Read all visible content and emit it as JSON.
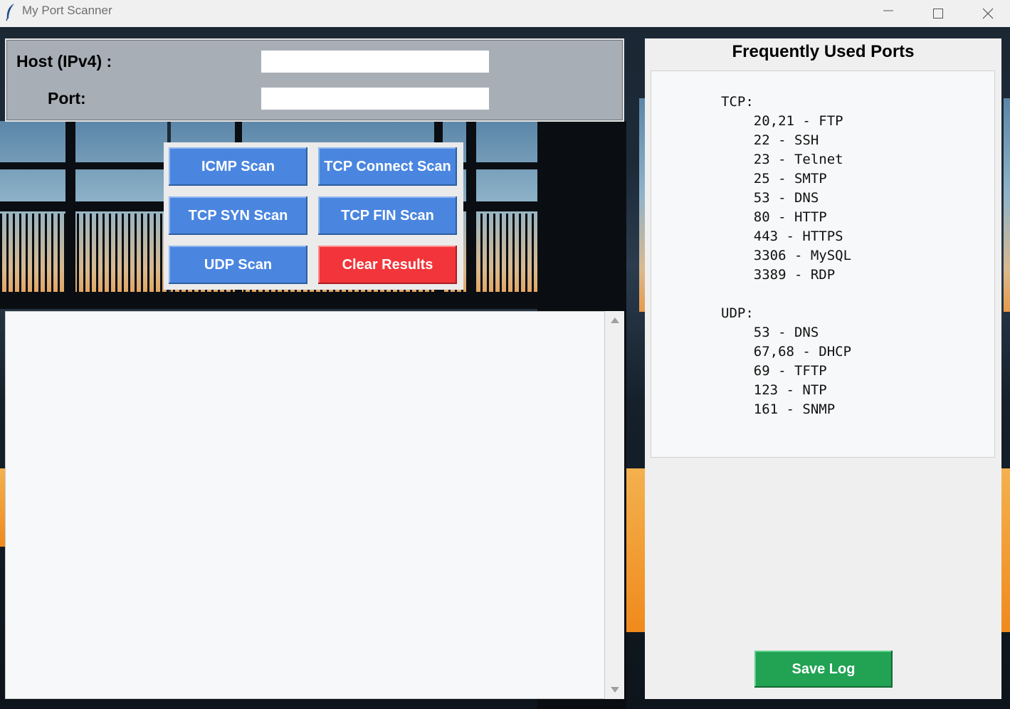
{
  "window": {
    "title": "My Port Scanner",
    "icon": "feather-icon",
    "controls": [
      "minimize-icon",
      "maximize-icon",
      "close-icon"
    ]
  },
  "form": {
    "host_label": "Host (IPv4) :",
    "port_label": "Port:",
    "host_value": "",
    "port_value": ""
  },
  "buttons": {
    "icmp": "ICMP Scan",
    "tcp_connect": "TCP Connect Scan",
    "tcp_syn": "TCP SYN Scan",
    "tcp_fin": "TCP FIN Scan",
    "udp": "UDP Scan",
    "clear": "Clear Results",
    "save_log": "Save Log"
  },
  "results": {
    "text": ""
  },
  "ports_panel": {
    "title": "Frequently Used Ports",
    "text": "TCP:\n    20,21 - FTP\n    22 - SSH\n    23 - Telnet\n    25 - SMTP\n    53 - DNS\n    80 - HTTP\n    443 - HTTPS\n    3306 - MySQL\n    3389 - RDP\n\nUDP:\n    53 - DNS\n    67,68 - DHCP\n    69 - TFTP\n    123 - NTP\n    161 - SNMP"
  },
  "colors": {
    "scan_button": "#4a86e0",
    "clear_button": "#f2353a",
    "save_button": "#21a353",
    "input_panel": "#a8aeb6"
  }
}
